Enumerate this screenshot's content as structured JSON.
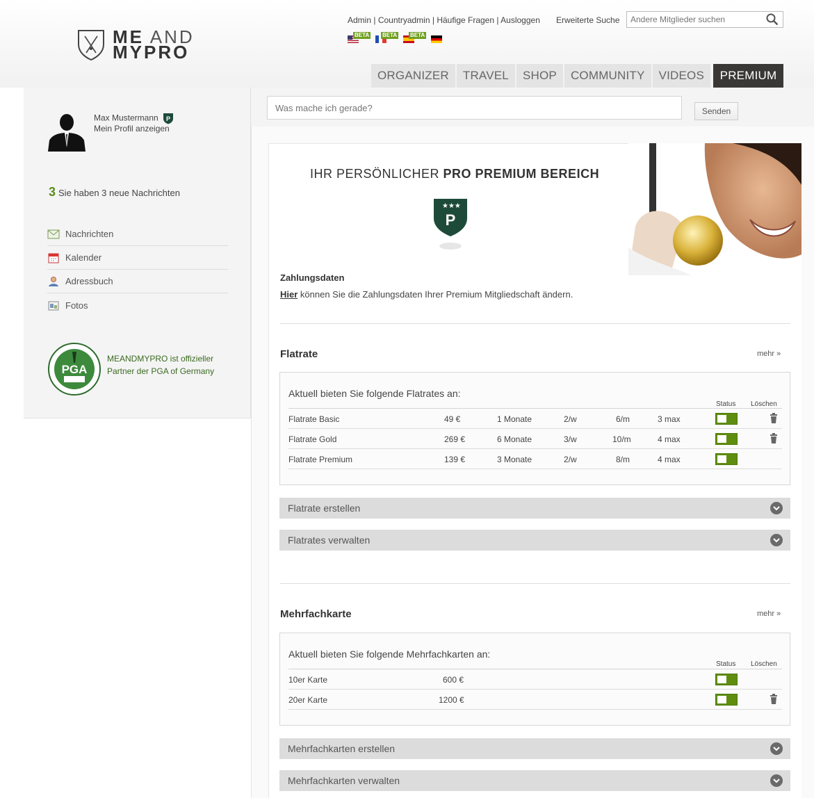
{
  "header": {
    "logo_line1_bold": "ME",
    "logo_line1_thin": "AND",
    "logo_line2": "MYPRO",
    "top_links": [
      "Admin",
      "Countryadmin",
      "Häufige Fragen",
      "Ausloggen"
    ],
    "link_separator": " | ",
    "advanced_search": "Erweiterte Suche",
    "search_placeholder": "Andere Mitglieder suchen",
    "beta_label": "BETA",
    "flags": [
      "us",
      "fr",
      "es",
      "de"
    ],
    "nav": [
      "ORGANIZER",
      "TRAVEL",
      "SHOP",
      "COMMUNITY",
      "VIDEOS"
    ],
    "nav_premium": "PREMIUM"
  },
  "sidebar": {
    "name": "Max Mustermann",
    "profile_link": "Mein Profil anzeigen",
    "new_count": "3",
    "new_messages": "Sie haben 3 neue Nachrichten",
    "menu": [
      {
        "label": "Nachrichten",
        "icon": "envelope-icon"
      },
      {
        "label": "Kalender",
        "icon": "calendar-icon"
      },
      {
        "label": "Adressbuch",
        "icon": "contact-icon"
      },
      {
        "label": "Fotos",
        "icon": "photo-icon"
      }
    ],
    "partner_text": "MEANDMYPRO ist offizieller Partner der PGA of Germany"
  },
  "status": {
    "placeholder": "Was mache ich gerade?",
    "send": "Senden"
  },
  "hero": {
    "title_plain": "IHR PERSÖNLICHER",
    "title_bold": "PRO PREMIUM BEREICH"
  },
  "payment": {
    "title": "Zahlungsdaten",
    "link": "Hier",
    "text": "können Sie die Zahlungsdaten Ihrer Premium Mitgliedschaft ändern."
  },
  "flatrate": {
    "title": "Flatrate",
    "more": "mehr »",
    "heading": "Aktuell bieten Sie folgende Flatrates an:",
    "col_status": "Status",
    "col_delete": "Löschen",
    "rows": [
      {
        "name": "Flatrate Basic",
        "price": "49 €",
        "duration": "1 Monate",
        "per_week": "2/w",
        "per_month": "6/m",
        "max": "3 max",
        "status_on": true,
        "deletable": true
      },
      {
        "name": "Flatrate Gold",
        "price": "269 €",
        "duration": "6 Monate",
        "per_week": "3/w",
        "per_month": "10/m",
        "max": "4 max",
        "status_on": true,
        "deletable": true
      },
      {
        "name": "Flatrate Premium",
        "price": "139 €",
        "duration": "3 Monate",
        "per_week": "2/w",
        "per_month": "8/m",
        "max": "4 max",
        "status_on": true,
        "deletable": false
      }
    ],
    "create": "Flatrate erstellen",
    "manage": "Flatrates verwalten"
  },
  "multicard": {
    "title": "Mehrfachkarte",
    "more": "mehr »",
    "heading": "Aktuell bieten Sie folgende Mehrfachkarten an:",
    "col_status": "Status",
    "col_delete": "Löschen",
    "rows": [
      {
        "name": "10er Karte",
        "price": "600 €",
        "status_on": true,
        "deletable": false
      },
      {
        "name": "20er Karte",
        "price": "1200 €",
        "status_on": true,
        "deletable": true
      }
    ],
    "create": "Mehrfachkarten erstellen",
    "manage": "Mehrfachkarten verwalten"
  },
  "colors": {
    "accent_green": "#5f8d10",
    "premium_tab": "#3a3837",
    "accordion_bg": "#dcdcdc"
  }
}
